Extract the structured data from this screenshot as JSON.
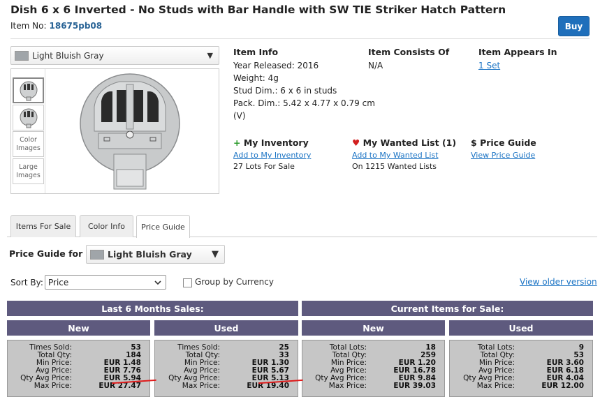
{
  "title": "Dish 6 x 6 Inverted - No Studs with Bar Handle with SW TIE Striker Hatch Pattern",
  "item_no_label": "Item No:",
  "item_no": "18675pb08",
  "buy_label": "Buy",
  "color_select": {
    "value": "Light Bluish Gray",
    "swatch": "#a0a5a9"
  },
  "thumbs": [
    "Color Images",
    "Large Images"
  ],
  "info": {
    "heading": "Item Info",
    "lines": [
      "Year Released: 2016",
      "Weight: 4g",
      "Stud Dim.: 6 x 6 in studs",
      "Pack. Dim.: 5.42 x 4.77 x 0.79 cm",
      "(V)"
    ]
  },
  "consists": {
    "heading": "Item Consists Of",
    "value": "N/A"
  },
  "appears": {
    "heading": "Item Appears In",
    "link": "1 Set"
  },
  "inventory": {
    "icon": "+",
    "heading": "My Inventory",
    "link": "Add to My Inventory",
    "sub": "27 Lots For Sale"
  },
  "wanted": {
    "icon": "♥",
    "heading": "My Wanted List (1)",
    "link": "Add to My Wanted List",
    "sub": "On 1215 Wanted Lists"
  },
  "price": {
    "icon": "$",
    "heading": "Price Guide",
    "link": "View Price Guide"
  },
  "tabs": [
    "Items For Sale",
    "Color Info",
    "Price Guide"
  ],
  "pg": {
    "label": "Price Guide for",
    "color": "Light Bluish Gray"
  },
  "sort": {
    "label": "Sort By:",
    "value": "Price"
  },
  "group_label": "Group by Currency",
  "older_link": "View older version",
  "sections": {
    "last6": "Last 6 Months Sales:",
    "current": "Current Items for Sale:"
  },
  "subheads": {
    "new": "New",
    "used": "Used"
  },
  "stats": [
    {
      "rows": [
        [
          "Times Sold:",
          "53"
        ],
        [
          "Total Qty:",
          "184"
        ],
        [
          "Min Price:",
          "EUR 1.48"
        ],
        [
          "Avg Price:",
          "EUR 7.76"
        ],
        [
          "Qty Avg Price:",
          "EUR 5.94"
        ],
        [
          "Max Price:",
          "EUR 27.47"
        ]
      ]
    },
    {
      "rows": [
        [
          "Times Sold:",
          "25"
        ],
        [
          "Total Qty:",
          "33"
        ],
        [
          "Min Price:",
          "EUR 1.30"
        ],
        [
          "Avg Price:",
          "EUR 5.67"
        ],
        [
          "Qty Avg Price:",
          "EUR 5.13"
        ],
        [
          "Max Price:",
          "EUR 19.40"
        ]
      ]
    },
    {
      "rows": [
        [
          "Total Lots:",
          "18"
        ],
        [
          "Total Qty:",
          "259"
        ],
        [
          "Min Price:",
          "EUR 1.20"
        ],
        [
          "Avg Price:",
          "EUR 16.78"
        ],
        [
          "Qty Avg Price:",
          "EUR 9.84"
        ],
        [
          "Max Price:",
          "EUR 39.03"
        ]
      ]
    },
    {
      "rows": [
        [
          "Total Lots:",
          "9"
        ],
        [
          "Total Qty:",
          "53"
        ],
        [
          "Min Price:",
          "EUR 3.60"
        ],
        [
          "Avg Price:",
          "EUR 6.18"
        ],
        [
          "Qty Avg Price:",
          "EUR 4.04"
        ],
        [
          "Max Price:",
          "EUR 12.00"
        ]
      ]
    }
  ]
}
